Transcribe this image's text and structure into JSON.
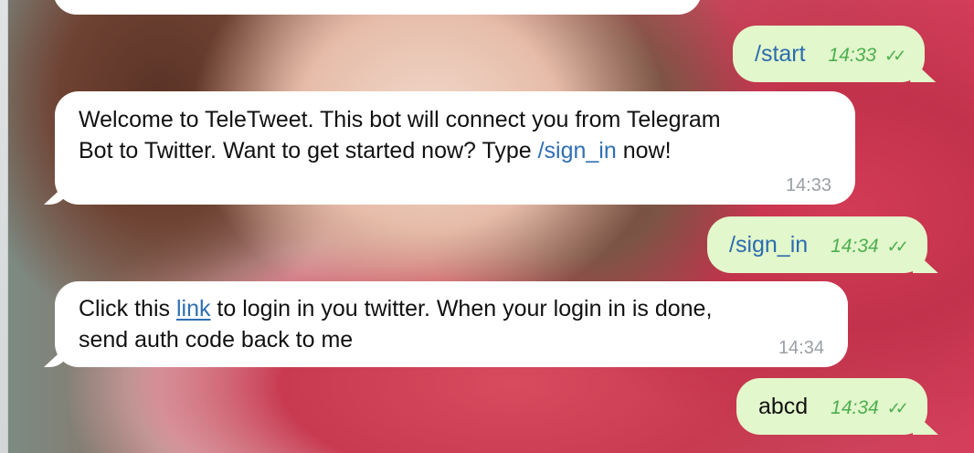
{
  "messages": [
    {
      "direction": "outgoing",
      "text": "/start",
      "time": "14:33",
      "status": "read"
    },
    {
      "direction": "incoming",
      "line1": "Welcome to TeleTweet. This bot will connect you from Telegram",
      "line2_before": "Bot to Twitter. Want to get started now? Type ",
      "line2_command": "/sign_in",
      "line2_after": " now!",
      "time": "14:33"
    },
    {
      "direction": "outgoing",
      "text": "/sign_in",
      "time": "14:34",
      "status": "read"
    },
    {
      "direction": "incoming",
      "line1_before": "Click this ",
      "line1_link": "link",
      "line1_after": " to login in you twitter. When your login in is done,",
      "line2": "send auth code back to me",
      "time": "14:34"
    },
    {
      "direction": "outgoing",
      "text": "abcd",
      "time": "14:34",
      "status": "read"
    }
  ],
  "icons": {
    "read_status": "double-check-icon"
  },
  "colors": {
    "incoming_bubble": "#ffffff",
    "outgoing_bubble": "#e2f7cb",
    "link": "#2f6fb3",
    "read_check": "#4caf50"
  }
}
